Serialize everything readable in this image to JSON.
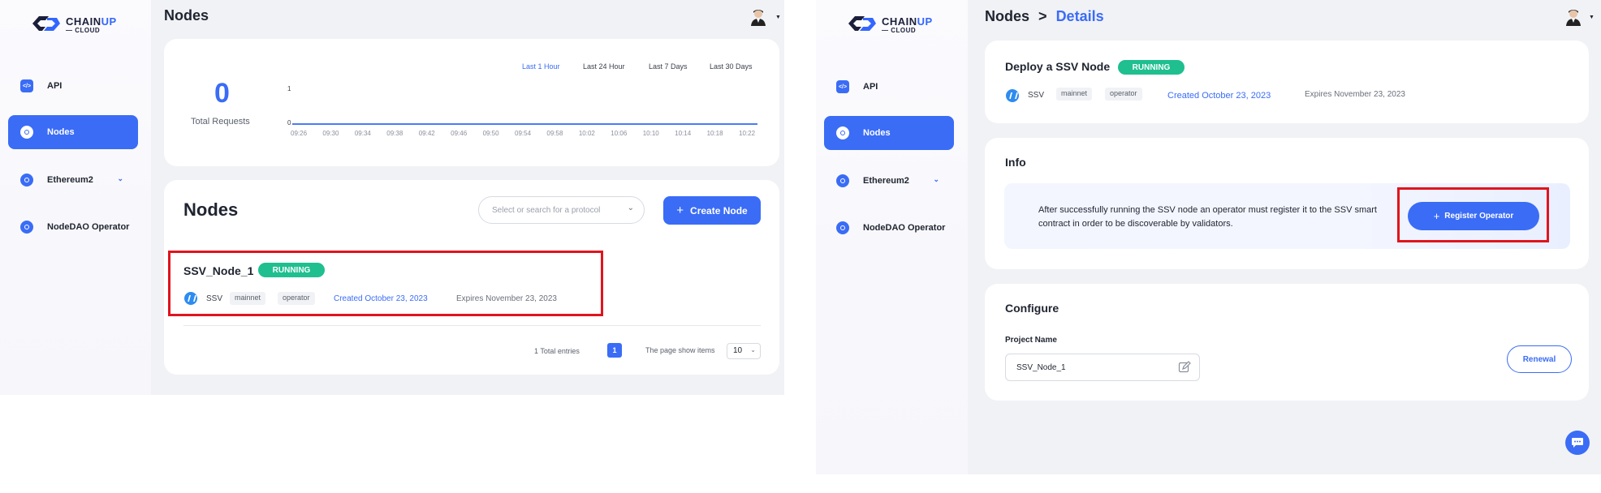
{
  "colors": {
    "accent": "#3a6cf6",
    "running": "#1fbf8f",
    "highlight": "#e0141e"
  },
  "brand": {
    "name_part1": "CHAIN",
    "name_part2": "UP",
    "sub": "— CLOUD"
  },
  "sidebar": {
    "items": [
      {
        "label": "API",
        "icon": "code-icon"
      },
      {
        "label": "Nodes",
        "icon": "nodes-icon",
        "active": true
      },
      {
        "label": "Ethereum2",
        "icon": "ethereum-icon",
        "expandable": true
      },
      {
        "label": "NodeDAO Operator",
        "icon": "nodedao-icon"
      }
    ]
  },
  "left": {
    "title": "Nodes",
    "stats": {
      "total_value": "0",
      "total_label": "Total Requests",
      "ranges": [
        "Last 1 Hour",
        "Last 24 Hour",
        "Last 7 Days",
        "Last 30 Days"
      ],
      "active_range": "Last 1 Hour"
    },
    "chart_data": {
      "type": "line",
      "title": "",
      "ylim": [
        0,
        1
      ],
      "y_ticks": [
        "1",
        "0"
      ],
      "x": [
        "09:26",
        "09:30",
        "09:34",
        "09:38",
        "09:42",
        "09:46",
        "09:50",
        "09:54",
        "09:58",
        "10:02",
        "10:06",
        "10:10",
        "10:14",
        "10:18",
        "10:22"
      ],
      "series": [
        {
          "values": [
            0,
            0,
            0,
            0,
            0,
            0,
            0,
            0,
            0,
            0,
            0,
            0,
            0,
            0,
            0
          ]
        }
      ]
    },
    "nodes_section": {
      "title": "Nodes",
      "select_placeholder": "Select or search for a protocol",
      "create_label": "Create Node",
      "node": {
        "name": "SSV_Node_1",
        "status": "RUNNING",
        "protocol": "SSV",
        "tags": [
          "mainnet",
          "operator"
        ],
        "created": "Created October 23, 2023",
        "expires": "Expires November 23, 2023"
      },
      "pagination": {
        "total": "1 Total entries",
        "page": "1",
        "show_label": "The page show items",
        "per_page": "10"
      }
    }
  },
  "right": {
    "breadcrumb": {
      "root": "Nodes",
      "sep": ">",
      "current": "Details"
    },
    "deploy": {
      "title": "Deploy a SSV Node",
      "status": "RUNNING",
      "protocol": "SSV",
      "tags": [
        "mainnet",
        "operator"
      ],
      "created": "Created October 23, 2023",
      "expires": "Expires November 23, 2023"
    },
    "info": {
      "title": "Info",
      "text": "After successfully running the SSV node an operator must register it to the SSV smart contract in order to be discoverable by validators.",
      "register_label": "Register Operator"
    },
    "configure": {
      "title": "Configure",
      "project_label": "Project Name",
      "project_value": "SSV_Node_1",
      "renewal_label": "Renewal"
    }
  }
}
